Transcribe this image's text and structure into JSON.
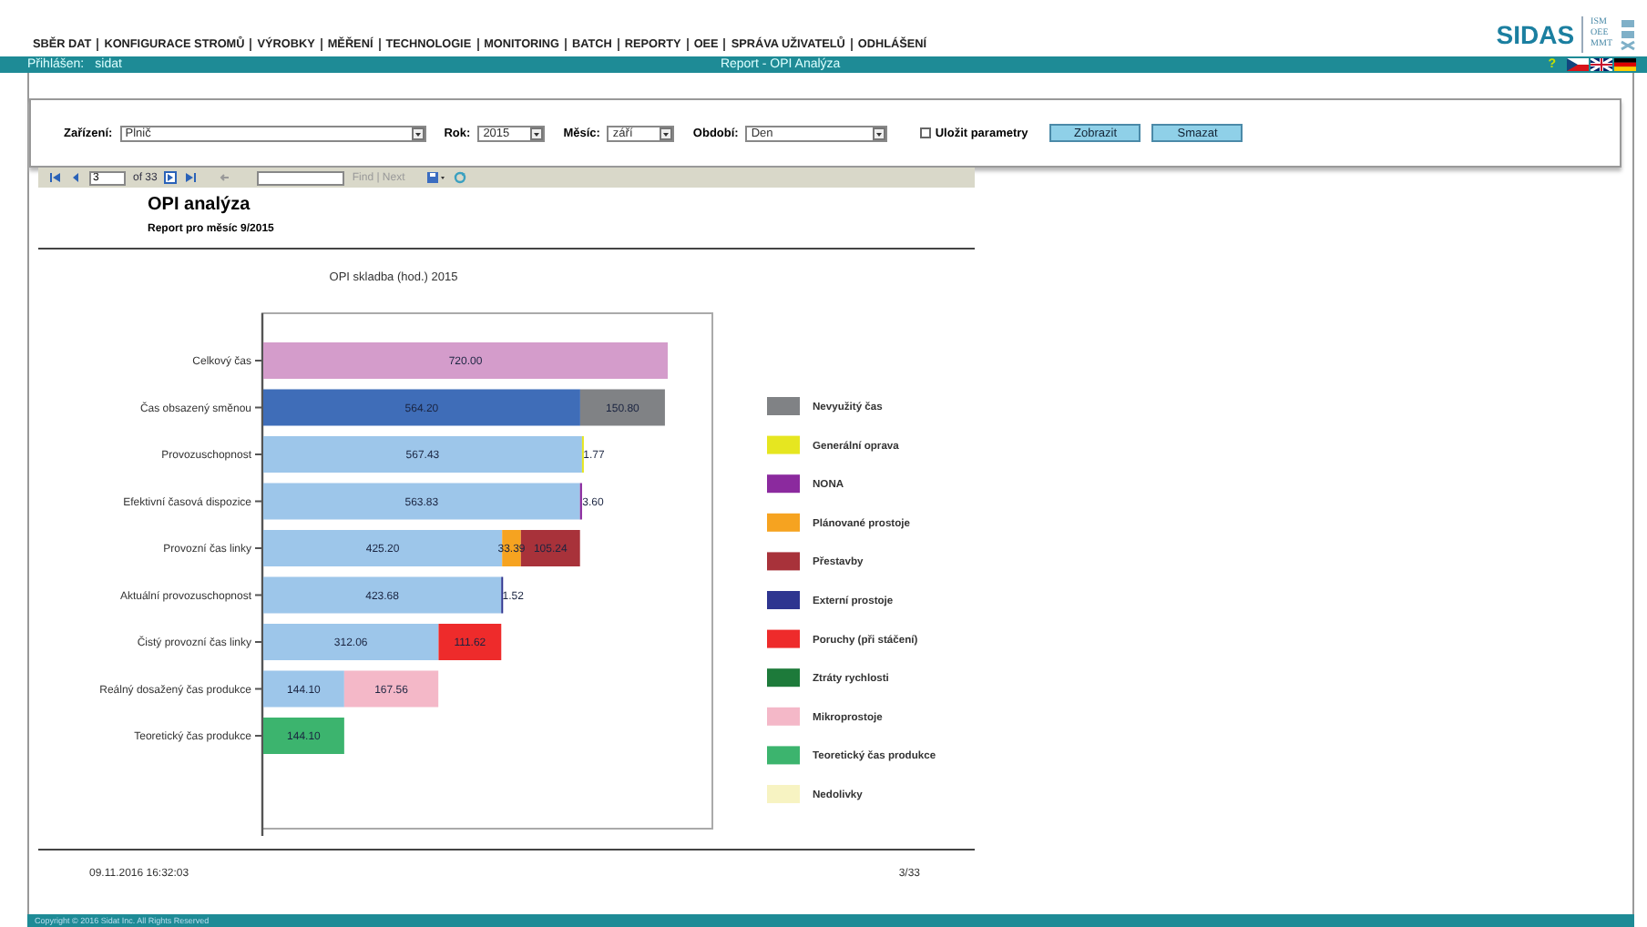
{
  "nav": {
    "menu": [
      "SBĚR DAT",
      "KONFIGURACE STROMŮ",
      "VÝROBKY",
      "MĚŘENÍ",
      "TECHNOLOGIE",
      "MONITORING",
      "BATCH",
      "REPORTY",
      "OEE",
      "SPRÁVA UŽIVATELŮ",
      "ODHLÁŠENÍ"
    ],
    "logo": {
      "name": "SIDAS",
      "lines": [
        "ISM",
        "OEE",
        "MMT"
      ]
    }
  },
  "status_bar": {
    "login_label": "Přihlášen:",
    "user": "sidat",
    "page_title": "Report - OPI Analýza",
    "help": "?"
  },
  "filters": {
    "fields": [
      {
        "label": "Zařízení:",
        "value": "Plnič",
        "kind": "wide"
      },
      {
        "label": "Rok:",
        "value": "2015",
        "kind": "short"
      },
      {
        "label": "Měsíc:",
        "value": "září",
        "kind": "short"
      },
      {
        "label": "Období:",
        "value": "Den",
        "kind": "medium"
      }
    ],
    "save_params": {
      "label": "Uložit parametry",
      "checked": false
    },
    "buttons": [
      "Zobrazit",
      "Smazat"
    ]
  },
  "report_toolbar": {
    "page": "3",
    "page_count": "of 33",
    "find_next": "Find | Next"
  },
  "report": {
    "title": "OPI analýza",
    "subtitle": "Report pro měsíc 9/2015",
    "chart_data": {
      "type": "bar",
      "orientation": "horizontal",
      "stacked": true,
      "data_labels": true,
      "legend": "right",
      "title": "OPI skladba (hod.) 2015",
      "categories": [
        "Celkový čas",
        "Čas obsazený směnou",
        "Provozuschopnost",
        "Efektivní časová dispozice",
        "Provozní čas linky",
        "Aktuální provozuschopnost",
        "Čistý provozní čas linky",
        "Reálný dosažený čas produkce",
        "Teoretický čas produkce"
      ],
      "series": [
        {
          "color": "#d49ccb",
          "values": [
            720.0,
            null,
            null,
            null,
            null,
            null,
            null,
            null,
            null
          ],
          "value_labels": [
            "720.00",
            null,
            null,
            null,
            null,
            null,
            null,
            null,
            null
          ]
        },
        {
          "color": "#3f6db8",
          "values": [
            null,
            564.2,
            null,
            null,
            null,
            null,
            null,
            null,
            null
          ],
          "value_labels": [
            null,
            "564.20",
            null,
            null,
            null,
            null,
            null,
            null,
            null
          ]
        },
        {
          "color": "#9dc6ea",
          "values": [
            null,
            null,
            567.43,
            563.83,
            425.2,
            423.68,
            312.06,
            144.1,
            null
          ],
          "value_labels": [
            null,
            null,
            "567.43",
            "563.83",
            "425.20",
            "423.68",
            "312.06",
            "144.10",
            null
          ]
        },
        {
          "name": "Nevyužitý čas",
          "color": "#808285",
          "values": [
            null,
            150.8,
            null,
            null,
            null,
            null,
            null,
            null,
            null
          ],
          "value_labels": [
            null,
            "150.80",
            null,
            null,
            null,
            null,
            null,
            null,
            null
          ]
        },
        {
          "name": "Generální oprava",
          "color": "#e6e620",
          "values": [
            null,
            null,
            1.77,
            null,
            null,
            null,
            null,
            null,
            null
          ],
          "value_labels": [
            null,
            null,
            "1.77",
            null,
            null,
            null,
            null,
            null,
            null
          ]
        },
        {
          "name": "NONA",
          "color": "#8b2a9e",
          "values": [
            null,
            null,
            null,
            3.6,
            null,
            null,
            null,
            null,
            null
          ],
          "value_labels": [
            null,
            null,
            null,
            "3.60",
            null,
            null,
            null,
            null,
            null
          ]
        },
        {
          "name": "Plánované prostoje",
          "color": "#f6a320",
          "values": [
            null,
            null,
            null,
            null,
            33.39,
            null,
            null,
            null,
            null
          ],
          "value_labels": [
            null,
            null,
            null,
            null,
            "33.39",
            null,
            null,
            null,
            null
          ]
        },
        {
          "name": "Přestavby",
          "color": "#a8323a",
          "values": [
            null,
            null,
            null,
            null,
            105.24,
            null,
            null,
            null,
            null
          ],
          "value_labels": [
            null,
            null,
            null,
            null,
            "105.24",
            null,
            null,
            null,
            null
          ]
        },
        {
          "name": "Externí prostoje",
          "color": "#2e3590",
          "values": [
            null,
            null,
            null,
            null,
            null,
            1.52,
            null,
            null,
            null
          ],
          "value_labels": [
            null,
            null,
            null,
            null,
            null,
            "1.52",
            null,
            null,
            null
          ]
        },
        {
          "name": "Poruchy (při stáčení)",
          "color": "#ee2b2b",
          "values": [
            null,
            null,
            null,
            null,
            null,
            null,
            111.62,
            null,
            null
          ],
          "value_labels": [
            null,
            null,
            null,
            null,
            null,
            null,
            "111.62",
            null,
            null
          ]
        },
        {
          "name": "Ztráty rychlosti",
          "color": "#1d7a3a",
          "values": [
            null,
            null,
            null,
            null,
            null,
            null,
            null,
            null,
            null
          ]
        },
        {
          "name": "Mikroprostoje",
          "color": "#f4b8c8",
          "values": [
            null,
            null,
            null,
            null,
            null,
            null,
            null,
            167.56,
            null
          ],
          "value_labels": [
            null,
            null,
            null,
            null,
            null,
            null,
            null,
            "167.56",
            null
          ]
        },
        {
          "name": "Teoretický čas produkce",
          "color": "#3cb46e",
          "values": [
            null,
            null,
            null,
            null,
            null,
            null,
            null,
            null,
            144.1
          ],
          "value_labels": [
            null,
            null,
            null,
            null,
            null,
            null,
            null,
            null,
            "144.10"
          ]
        },
        {
          "name": "Nedolivky",
          "color": "#f7f3c2",
          "values": [
            null,
            null,
            null,
            null,
            null,
            null,
            null,
            null,
            null
          ]
        }
      ]
    },
    "footer": {
      "printed": "09.11.2016 16:32:03",
      "page": "3/33"
    }
  },
  "copyright": "Copyright © 2016 Sidat Inc. All Rights Reserved"
}
